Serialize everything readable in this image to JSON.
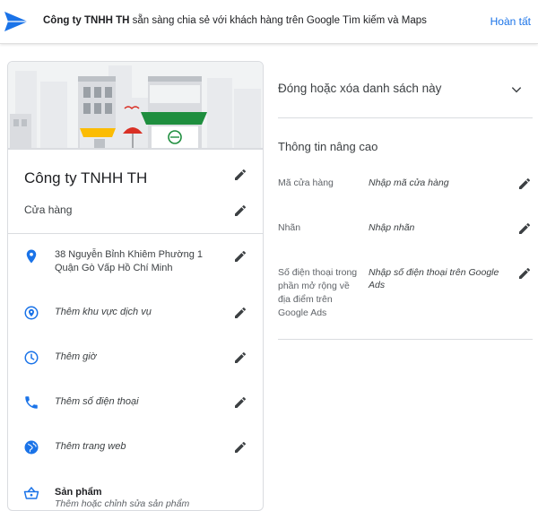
{
  "header": {
    "company_bold": "Công ty TNHH TH",
    "message_rest": " sẵn sàng chia sẻ với khách hàng trên Google Tìm kiếm và Maps",
    "done_label": "Hoàn tất"
  },
  "business": {
    "name": "Công ty TNHH TH",
    "category": "Cửa hàng",
    "rows": [
      {
        "icon": "location-pin-icon",
        "text": "38 Nguyễn Bỉnh Khiêm Phường 1 Quận Gò Vấp Hồ Chí Minh"
      },
      {
        "icon": "service-area-icon",
        "text": "Thêm khu vực dịch vụ"
      },
      {
        "icon": "clock-icon",
        "text": "Thêm giờ"
      },
      {
        "icon": "phone-icon",
        "text": "Thêm số điện thoại"
      },
      {
        "icon": "globe-icon",
        "text": "Thêm trang web"
      },
      {
        "icon": "basket-icon",
        "text": "Sản phẩm",
        "sub": "Thêm hoặc chỉnh sửa sản phẩm"
      }
    ]
  },
  "right_panel": {
    "close_title": "Đóng hoặc xóa danh sách này",
    "advanced_title": "Thông tin nâng cao",
    "fields": [
      {
        "label": "Mã cửa hàng",
        "placeholder": "Nhập mã cửa hàng"
      },
      {
        "label": "Nhãn",
        "placeholder": "Nhập nhãn"
      },
      {
        "label": "Số điện thoại trong phần mở rộng về địa điểm trên Google Ads",
        "placeholder": "Nhập số điện thoại trên Google Ads"
      }
    ]
  },
  "colors": {
    "accent": "#1a73e8",
    "awning_green": "#1e8e3e",
    "awning_red": "#d93025"
  }
}
